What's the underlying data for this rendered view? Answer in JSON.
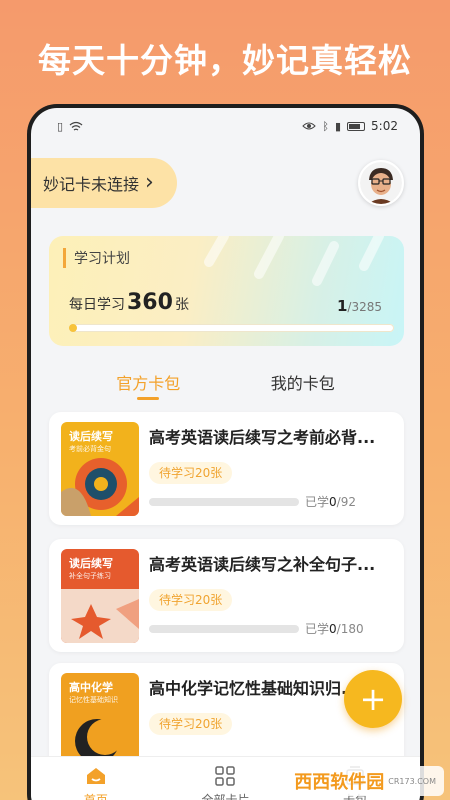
{
  "headline": "每天十分钟，妙记真轻松",
  "status_bar": {
    "time": "5:02"
  },
  "connect": {
    "label": "妙记卡未连接",
    "arrow": "›"
  },
  "plan": {
    "title": "学习计划",
    "daily_prefix": "每日学习",
    "daily_count": "360",
    "daily_suffix": "张",
    "progress_current": "1",
    "progress_total": "/3285",
    "progress_fraction": 0.0003
  },
  "tabs": [
    {
      "label": "官方卡包",
      "active": true
    },
    {
      "label": "我的卡包",
      "active": false
    }
  ],
  "cards": [
    {
      "title": "高考英语读后续写之考前必背...",
      "cover_title": "读后续写",
      "cover_sub": "考前必背金句",
      "cover_color": "#f2b21c",
      "pending": "待学习20张",
      "learned_label": "已学",
      "learned_count": "0",
      "learned_total": "/92"
    },
    {
      "title": "高考英语读后续写之补全句子...",
      "cover_title": "读后续写",
      "cover_sub": "补全句子练习",
      "cover_color": "#e55a2e",
      "pending": "待学习20张",
      "learned_label": "已学",
      "learned_count": "0",
      "learned_total": "/180"
    },
    {
      "title": "高中化学记忆性基础知识归...",
      "cover_title": "高中化学",
      "cover_sub": "记忆性基础知识",
      "cover_color": "#f0a020",
      "pending": "待学习20张",
      "learned_label": "",
      "learned_count": "",
      "learned_total": ""
    }
  ],
  "fab": {
    "label": "+"
  },
  "nav": [
    {
      "label": "首页",
      "icon": "home-icon",
      "active": true
    },
    {
      "label": "全部卡片",
      "icon": "grid-icon",
      "active": false
    },
    {
      "label": "卡包",
      "icon": "card-pack-icon",
      "active": false
    }
  ],
  "watermark": {
    "text": "西西软件园",
    "site": "CR173.COM"
  },
  "colors": {
    "accent": "#f3a12a",
    "fab": "#f6b81f",
    "bg_top": "#f59a6c"
  }
}
